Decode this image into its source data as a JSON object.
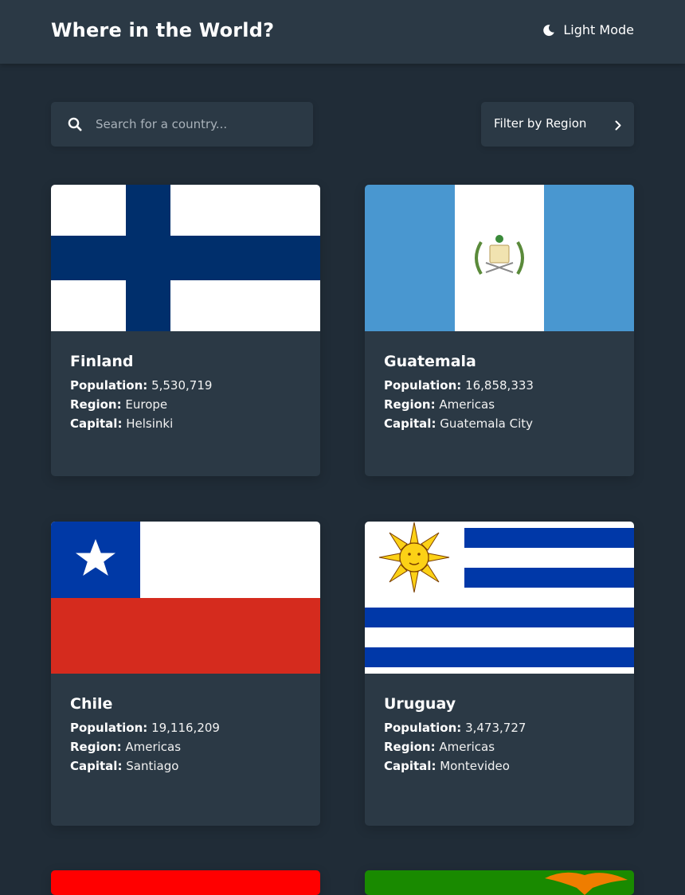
{
  "header": {
    "title": "Where in the World?",
    "theme_label": "Light Mode"
  },
  "search": {
    "placeholder": "Search for a country..."
  },
  "filter": {
    "label": "Filter by Region"
  },
  "stat_labels": {
    "population": "Population:",
    "region": "Region:",
    "capital": "Capital:"
  },
  "colors": {
    "background": "#202c37",
    "element": "#2b3945",
    "text": "#ffffff"
  },
  "countries": [
    {
      "name": "Finland",
      "population": "5,530,719",
      "region": "Europe",
      "capital": "Helsinki",
      "flag": "finland-flag"
    },
    {
      "name": "Guatemala",
      "population": "16,858,333",
      "region": "Americas",
      "capital": "Guatemala City",
      "flag": "guatemala-flag"
    },
    {
      "name": "Chile",
      "population": "19,116,209",
      "region": "Americas",
      "capital": "Santiago",
      "flag": "chile-flag"
    },
    {
      "name": "Uruguay",
      "population": "3,473,727",
      "region": "Americas",
      "capital": "Montevideo",
      "flag": "uruguay-flag"
    }
  ],
  "partial_flags": [
    "red-flag",
    "zambia-flag"
  ]
}
